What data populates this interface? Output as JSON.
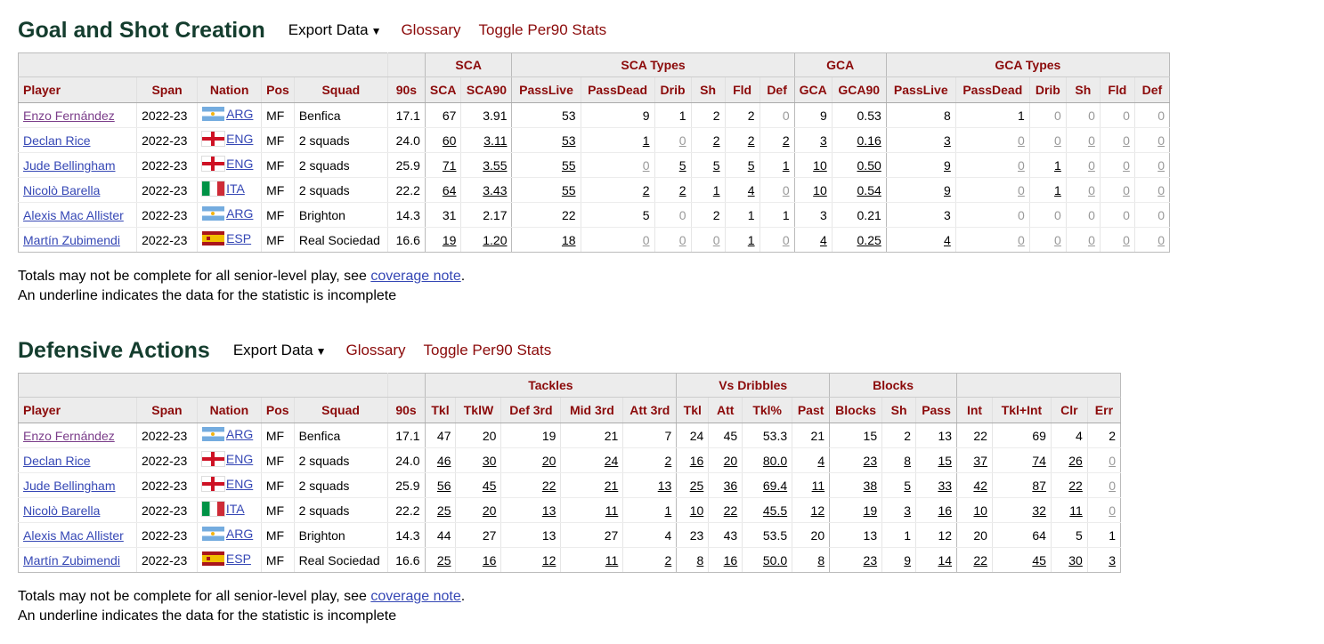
{
  "common": {
    "export_label": "Export Data",
    "glossary_label": "Glossary",
    "toggle_label": "Toggle Per90 Stats",
    "note_line1_prefix": "Totals may not be complete for all senior-level play, see ",
    "note_link": "coverage note",
    "note_line1_suffix": ".",
    "note_line2": "An underline indicates the data for the statistic is incomplete"
  },
  "gsc": {
    "title": "Goal and Shot Creation",
    "groups": {
      "sca": "SCA",
      "sca_types": "SCA Types",
      "gca": "GCA",
      "gca_types": "GCA Types"
    },
    "columns": [
      "Player",
      "Span",
      "Nation",
      "Pos",
      "Squad",
      "90s",
      "SCA",
      "SCA90",
      "PassLive",
      "PassDead",
      "Drib",
      "Sh",
      "Fld",
      "Def",
      "GCA",
      "GCA90",
      "PassLive",
      "PassDead",
      "Drib",
      "Sh",
      "Fld",
      "Def"
    ],
    "rows": [
      {
        "player": "Enzo Fernández",
        "span": "2022-23",
        "nation": "ARG",
        "flag": "arg",
        "pos": "MF",
        "squad": "Benfica",
        "nineties": "17.1",
        "v": [
          "67",
          "3.91",
          "53",
          "9",
          "1",
          "2",
          "2",
          "0",
          "9",
          "0.53",
          "8",
          "1",
          "0",
          "0",
          "0",
          "0"
        ]
      },
      {
        "player": "Declan Rice",
        "span": "2022-23",
        "nation": "ENG",
        "flag": "eng",
        "pos": "MF",
        "squad": "2 squads",
        "nineties": "24.0",
        "v": [
          "60",
          "3.11",
          "53",
          "1",
          "0",
          "2",
          "2",
          "2",
          "3",
          "0.16",
          "3",
          "0",
          "0",
          "0",
          "0",
          "0"
        ]
      },
      {
        "player": "Jude Bellingham",
        "span": "2022-23",
        "nation": "ENG",
        "flag": "eng",
        "pos": "MF",
        "squad": "2 squads",
        "nineties": "25.9",
        "v": [
          "71",
          "3.55",
          "55",
          "0",
          "5",
          "5",
          "5",
          "1",
          "10",
          "0.50",
          "9",
          "0",
          "1",
          "0",
          "0",
          "0"
        ]
      },
      {
        "player": "Nicolò Barella",
        "span": "2022-23",
        "nation": "ITA",
        "flag": "ita",
        "pos": "MF",
        "squad": "2 squads",
        "nineties": "22.2",
        "v": [
          "64",
          "3.43",
          "55",
          "2",
          "2",
          "1",
          "4",
          "0",
          "10",
          "0.54",
          "9",
          "0",
          "1",
          "0",
          "0",
          "0"
        ]
      },
      {
        "player": "Alexis Mac Allister",
        "span": "2022-23",
        "nation": "ARG",
        "flag": "arg",
        "pos": "MF",
        "squad": "Brighton",
        "nineties": "14.3",
        "v": [
          "31",
          "2.17",
          "22",
          "5",
          "0",
          "2",
          "1",
          "1",
          "3",
          "0.21",
          "3",
          "0",
          "0",
          "0",
          "0",
          "0"
        ]
      },
      {
        "player": "Martín Zubimendi",
        "span": "2022-23",
        "nation": "ESP",
        "flag": "esp",
        "pos": "MF",
        "squad": "Real Sociedad",
        "nineties": "16.6",
        "v": [
          "19",
          "1.20",
          "18",
          "0",
          "0",
          "0",
          "1",
          "0",
          "4",
          "0.25",
          "4",
          "0",
          "0",
          "0",
          "0",
          "0"
        ]
      }
    ]
  },
  "def": {
    "title": "Defensive Actions",
    "groups": {
      "tackles": "Tackles",
      "vs_dribbles": "Vs Dribbles",
      "blocks": "Blocks"
    },
    "columns": [
      "Player",
      "Span",
      "Nation",
      "Pos",
      "Squad",
      "90s",
      "Tkl",
      "TklW",
      "Def 3rd",
      "Mid 3rd",
      "Att 3rd",
      "Tkl",
      "Att",
      "Tkl%",
      "Past",
      "Blocks",
      "Sh",
      "Pass",
      "Int",
      "Tkl+Int",
      "Clr",
      "Err"
    ],
    "rows": [
      {
        "player": "Enzo Fernández",
        "span": "2022-23",
        "nation": "ARG",
        "flag": "arg",
        "pos": "MF",
        "squad": "Benfica",
        "nineties": "17.1",
        "v": [
          "47",
          "20",
          "19",
          "21",
          "7",
          "24",
          "45",
          "53.3",
          "21",
          "15",
          "2",
          "13",
          "22",
          "69",
          "4",
          "2"
        ]
      },
      {
        "player": "Declan Rice",
        "span": "2022-23",
        "nation": "ENG",
        "flag": "eng",
        "pos": "MF",
        "squad": "2 squads",
        "nineties": "24.0",
        "v": [
          "46",
          "30",
          "20",
          "24",
          "2",
          "16",
          "20",
          "80.0",
          "4",
          "23",
          "8",
          "15",
          "37",
          "74",
          "26",
          "0"
        ]
      },
      {
        "player": "Jude Bellingham",
        "span": "2022-23",
        "nation": "ENG",
        "flag": "eng",
        "pos": "MF",
        "squad": "2 squads",
        "nineties": "25.9",
        "v": [
          "56",
          "45",
          "22",
          "21",
          "13",
          "25",
          "36",
          "69.4",
          "11",
          "38",
          "5",
          "33",
          "42",
          "87",
          "22",
          "0"
        ]
      },
      {
        "player": "Nicolò Barella",
        "span": "2022-23",
        "nation": "ITA",
        "flag": "ita",
        "pos": "MF",
        "squad": "2 squads",
        "nineties": "22.2",
        "v": [
          "25",
          "20",
          "13",
          "11",
          "1",
          "10",
          "22",
          "45.5",
          "12",
          "19",
          "3",
          "16",
          "10",
          "32",
          "11",
          "0"
        ]
      },
      {
        "player": "Alexis Mac Allister",
        "span": "2022-23",
        "nation": "ARG",
        "flag": "arg",
        "pos": "MF",
        "squad": "Brighton",
        "nineties": "14.3",
        "v": [
          "44",
          "27",
          "13",
          "27",
          "4",
          "23",
          "43",
          "53.5",
          "20",
          "13",
          "1",
          "12",
          "20",
          "64",
          "5",
          "1"
        ]
      },
      {
        "player": "Martín Zubimendi",
        "span": "2022-23",
        "nation": "ESP",
        "flag": "esp",
        "pos": "MF",
        "squad": "Real Sociedad",
        "nineties": "16.6",
        "v": [
          "25",
          "16",
          "12",
          "11",
          "2",
          "8",
          "16",
          "50.0",
          "8",
          "23",
          "9",
          "14",
          "22",
          "45",
          "30",
          "3"
        ]
      }
    ]
  }
}
